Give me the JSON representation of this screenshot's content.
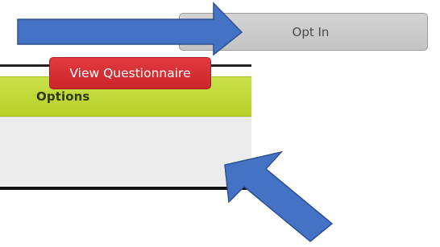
{
  "opt_in_button": {
    "label": "Opt In"
  },
  "options_panel": {
    "header": "Options",
    "view_questionnaire_label": "View Questionnaire"
  },
  "annotations": {
    "arrow_color": "#4472c4",
    "arrow_stroke": "#2f528f",
    "arrows": [
      "arrow-right-icon",
      "arrow-up-left-icon"
    ]
  },
  "colors": {
    "options_header": "#c2d93a",
    "view_questionnaire_button": "#d7292f",
    "opt_in_button": "#cccccc"
  }
}
